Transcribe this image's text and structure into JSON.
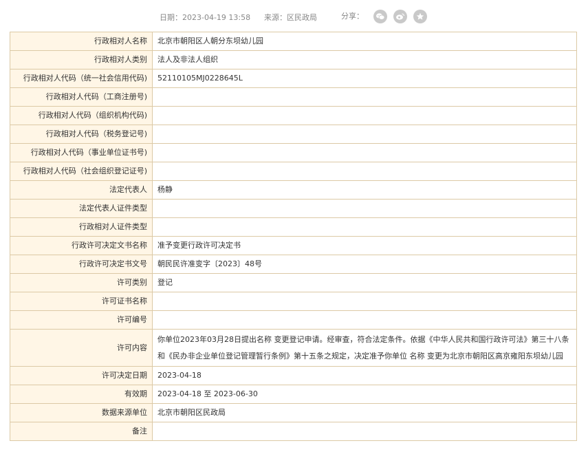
{
  "meta": {
    "date_label": "日期：",
    "date_value": "2023-04-19 13:58",
    "source_label": "来源：",
    "source_value": "区民政局",
    "share_label": "分享：",
    "share_icons": [
      "wechat-icon",
      "weibo-icon",
      "favorite-star-icon"
    ]
  },
  "rows": [
    {
      "label": "行政相对人名称",
      "value": "北京市朝阳区人朝分东坝幼儿园"
    },
    {
      "label": "行政相对人类别",
      "value": "法人及非法人组织"
    },
    {
      "label": "行政相对人代码（统一社会信用代码)",
      "value": "52110105MJ0228645L"
    },
    {
      "label": "行政相对人代码（工商注册号)",
      "value": ""
    },
    {
      "label": "行政相对人代码（组织机构代码)",
      "value": ""
    },
    {
      "label": "行政相对人代码（税务登记号)",
      "value": ""
    },
    {
      "label": "行政相对人代码（事业单位证书号)",
      "value": ""
    },
    {
      "label": "行政相对人代码（社会组织登记证号)",
      "value": ""
    },
    {
      "label": "法定代表人",
      "value": "杨静"
    },
    {
      "label": "法定代表人证件类型",
      "value": ""
    },
    {
      "label": "行政相对人证件类型",
      "value": ""
    },
    {
      "label": "行政许可决定文书名称",
      "value": "准予变更行政许可决定书"
    },
    {
      "label": "行政许可决定书文号",
      "value": "朝民民许准变字〔2023〕48号"
    },
    {
      "label": "许可类别",
      "value": "登记"
    },
    {
      "label": "许可证书名称",
      "value": ""
    },
    {
      "label": "许可编号",
      "value": ""
    },
    {
      "label": "许可内容",
      "value": "你单位2023年03月28日提出名称 变更登记申请。经审查，符合法定条件。依据《中华人民共和国行政许可法》第三十八条和《民办非企业单位登记管理暂行条例》第十五条之规定，决定准予你单位 名称 变更为北京市朝阳区高京雍阳东坝幼儿园"
    },
    {
      "label": "许可决定日期",
      "value": "2023-04-18"
    },
    {
      "label": "有效期",
      "value": "2023-04-18 至 2023-06-30"
    },
    {
      "label": "数据来源单位",
      "value": "北京市朝阳区民政局"
    },
    {
      "label": "备注",
      "value": ""
    }
  ]
}
